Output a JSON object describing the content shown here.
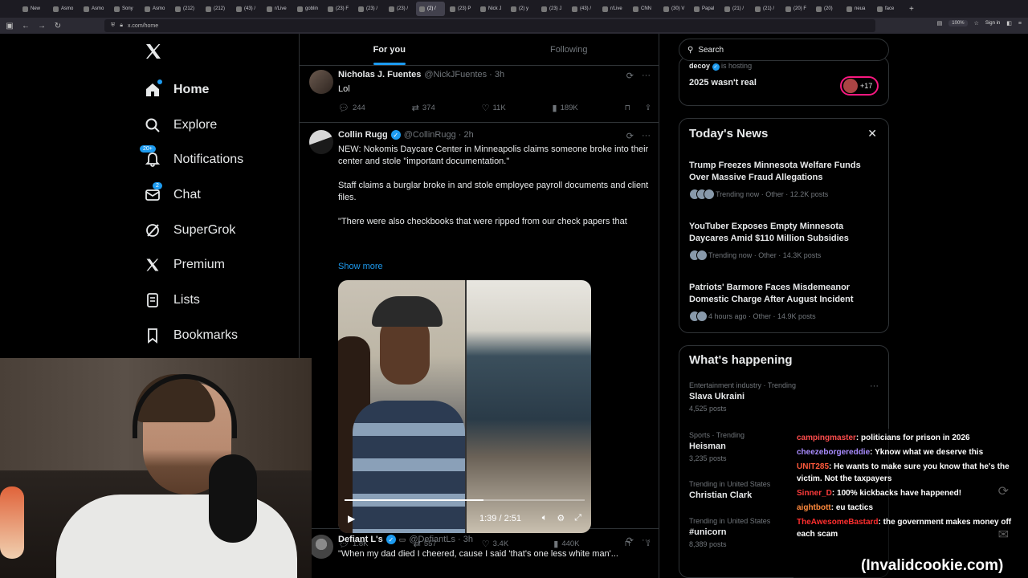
{
  "browser": {
    "tabs": [
      {
        "label": "New"
      },
      {
        "label": "Asmo"
      },
      {
        "label": "Asmo"
      },
      {
        "label": "Sony"
      },
      {
        "label": "Asmo"
      },
      {
        "label": "(212)"
      },
      {
        "label": "(212)"
      },
      {
        "label": "(43) /"
      },
      {
        "label": "r/Live"
      },
      {
        "label": "goblin"
      },
      {
        "label": "(23) F"
      },
      {
        "label": "(23) /"
      },
      {
        "label": "(23) /"
      },
      {
        "label": "(2) /"
      },
      {
        "label": "(23) P"
      },
      {
        "label": "Nick J"
      },
      {
        "label": "(2) y"
      },
      {
        "label": "(23) J"
      },
      {
        "label": "(43) /"
      },
      {
        "label": "r/Live"
      },
      {
        "label": "CNN"
      },
      {
        "label": "(30) V"
      },
      {
        "label": "Papal"
      },
      {
        "label": "(21) /"
      },
      {
        "label": "(21) /"
      },
      {
        "label": "(20) F"
      },
      {
        "label": "(20)"
      },
      {
        "label": "neua"
      },
      {
        "label": "face"
      }
    ],
    "url": "x.com/home",
    "zoom": "100%",
    "sign_in": "Sign in"
  },
  "sidebar": {
    "items": [
      {
        "label": "Home",
        "icon": "home-icon"
      },
      {
        "label": "Explore",
        "icon": "search-icon"
      },
      {
        "label": "Notifications",
        "icon": "bell-icon",
        "badge": "20+"
      },
      {
        "label": "Chat",
        "icon": "mail-icon",
        "badge": "2"
      },
      {
        "label": "SuperGrok",
        "icon": "grok-icon"
      },
      {
        "label": "Premium",
        "icon": "x-icon"
      },
      {
        "label": "Lists",
        "icon": "list-icon"
      },
      {
        "label": "Bookmarks",
        "icon": "bookmark-icon"
      }
    ]
  },
  "feed": {
    "tabs": [
      {
        "label": "For you"
      },
      {
        "label": "Following"
      }
    ],
    "tweets": [
      {
        "name": "Nicholas J. Fuentes",
        "handle": "@NickJFuentes · 3h",
        "text": "Lol",
        "replies": "244",
        "reposts": "374",
        "likes": "11K",
        "views": "189K"
      },
      {
        "name": "Collin Rugg",
        "handle": "@CollinRugg · 2h",
        "text": "NEW: Nokomis Daycare Center in Minneapolis claims someone broke into their center and stole \"important documentation.\"\n\nStaff claims a burglar broke in and stole employee payroll documents and client files.\n\n\"There were also checkbooks that were ripped from our check papers that",
        "show_more": "Show more",
        "video_time": "1:39 / 2:51",
        "video_progress": 0.58,
        "replies": "1.8K",
        "reposts": "557",
        "likes": "3.4K",
        "views": "440K"
      },
      {
        "name": "Defiant L's",
        "handle": "@DefiantLs · 3h",
        "text": "\"When my dad died I cheered, cause I said 'that's one less white man'..."
      }
    ]
  },
  "right": {
    "search_placeholder": "Search",
    "space": {
      "host_name": "decoy",
      "host_suffix": "is hosting",
      "title": "2025 wasn't real",
      "listeners": "+17"
    },
    "news": {
      "title": "Today's News",
      "items": [
        {
          "headline": "Trump Freezes Minnesota Welfare Funds Over Massive Fraud Allegations",
          "meta": "Trending now · Other · 12.2K posts"
        },
        {
          "headline": "YouTuber Exposes Empty Minnesota Daycares Amid $110 Million Subsidies",
          "meta": "Trending now · Other · 14.3K posts"
        },
        {
          "headline": "Patriots' Barmore Faces Misdemeanor Domestic Charge After August Incident",
          "meta": "4 hours ago · Other · 14.9K posts"
        }
      ]
    },
    "happening": {
      "title": "What's happening",
      "trends": [
        {
          "context": "Entertainment industry · Trending",
          "name": "Slava Ukraini",
          "count": "4,525 posts"
        },
        {
          "context": "Sports · Trending",
          "name": "Heisman",
          "count": "3,235 posts"
        },
        {
          "context": "Trending in United States",
          "name": "Christian Clark",
          "count": ""
        },
        {
          "context": "Trending in United States",
          "name": "#unicorn",
          "count": "8,389 posts"
        }
      ]
    }
  },
  "chat": {
    "messages": [
      {
        "user": "campingmaster",
        "color": "#ff4d4d",
        "text": "politicians for prison in 2026"
      },
      {
        "user": "cheezeborgereddie",
        "color": "#a98cff",
        "text": "Yknow what we deserve this"
      },
      {
        "user": "UNIT285",
        "color": "#ff5a3c",
        "text": "He wants to make sure you know that he's the victim. Not the taxpayers"
      },
      {
        "user": "Sinner_D",
        "color": "#ff3b3b",
        "text": "100% kickbacks have happened!"
      },
      {
        "user": "aightbott",
        "color": "#ff8a3d",
        "text": "eu tactics"
      },
      {
        "user": "TheAwesomeBastard",
        "color": "#ff2e2e",
        "text": "the government makes money off each scam"
      }
    ]
  },
  "watermark": "(Invalidcookie.com)"
}
